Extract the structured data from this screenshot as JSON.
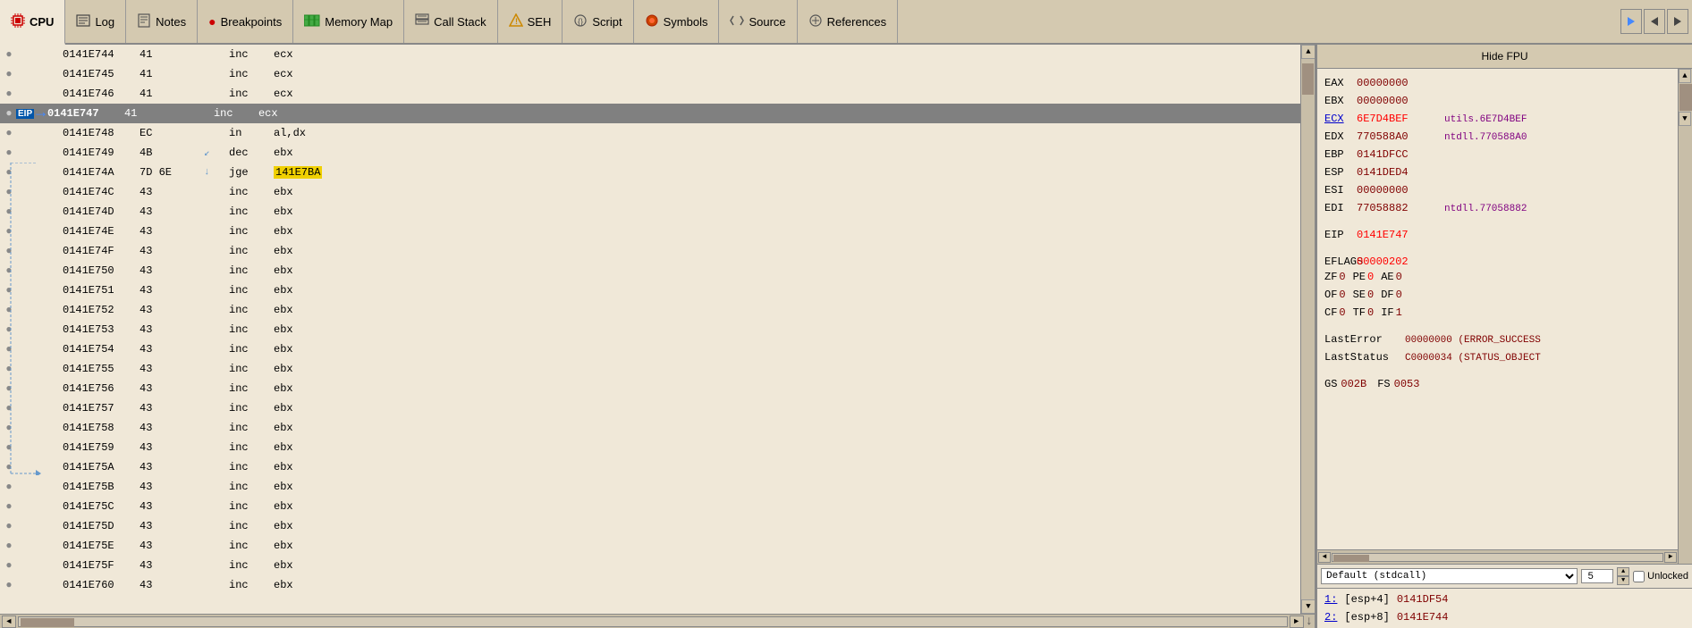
{
  "tabs": [
    {
      "id": "cpu",
      "label": "CPU",
      "icon": "cpu-icon",
      "active": true
    },
    {
      "id": "log",
      "label": "Log",
      "icon": "log-icon",
      "active": false
    },
    {
      "id": "notes",
      "label": "Notes",
      "icon": "notes-icon",
      "active": false
    },
    {
      "id": "breakpoints",
      "label": "Breakpoints",
      "icon": "breakpoints-icon",
      "active": false
    },
    {
      "id": "memmap",
      "label": "Memory Map",
      "icon": "memmap-icon",
      "active": false
    },
    {
      "id": "callstack",
      "label": "Call Stack",
      "icon": "callstack-icon",
      "active": false
    },
    {
      "id": "seh",
      "label": "SEH",
      "icon": "seh-icon",
      "active": false
    },
    {
      "id": "script",
      "label": "Script",
      "icon": "script-icon",
      "active": false
    },
    {
      "id": "symbols",
      "label": "Symbols",
      "icon": "symbols-icon",
      "active": false
    },
    {
      "id": "source",
      "label": "Source",
      "icon": "source-icon",
      "active": false
    },
    {
      "id": "references",
      "label": "References",
      "icon": "references-icon",
      "active": false
    }
  ],
  "disasm": {
    "rows": [
      {
        "addr": "0141E744",
        "hex": "41",
        "jump_arrow": "",
        "mnem": "inc",
        "oper": "ecx",
        "is_eip": false,
        "is_jge": false
      },
      {
        "addr": "0141E745",
        "hex": "41",
        "jump_arrow": "",
        "mnem": "inc",
        "oper": "ecx",
        "is_eip": false,
        "is_jge": false
      },
      {
        "addr": "0141E746",
        "hex": "41",
        "jump_arrow": "",
        "mnem": "inc",
        "oper": "ecx",
        "is_eip": false,
        "is_jge": false
      },
      {
        "addr": "0141E747",
        "hex": "41",
        "jump_arrow": "",
        "mnem": "inc",
        "oper": "ecx",
        "is_eip": true,
        "is_jge": false
      },
      {
        "addr": "0141E748",
        "hex": "EC",
        "jump_arrow": "",
        "mnem": "in",
        "oper": "al,dx",
        "is_eip": false,
        "is_jge": false
      },
      {
        "addr": "0141E749",
        "hex": "4B",
        "jump_arrow": "↙",
        "mnem": "dec",
        "oper": "ebx",
        "is_eip": false,
        "is_jge": false
      },
      {
        "addr": "0141E74A",
        "hex": "7D 6E",
        "jump_arrow": "↓",
        "mnem": "jge",
        "oper": "141E7BA",
        "is_eip": false,
        "is_jge": true
      },
      {
        "addr": "0141E74C",
        "hex": "43",
        "jump_arrow": "",
        "mnem": "inc",
        "oper": "ebx",
        "is_eip": false,
        "is_jge": false
      },
      {
        "addr": "0141E74D",
        "hex": "43",
        "jump_arrow": "",
        "mnem": "inc",
        "oper": "ebx",
        "is_eip": false,
        "is_jge": false
      },
      {
        "addr": "0141E74E",
        "hex": "43",
        "jump_arrow": "",
        "mnem": "inc",
        "oper": "ebx",
        "is_eip": false,
        "is_jge": false
      },
      {
        "addr": "0141E74F",
        "hex": "43",
        "jump_arrow": "",
        "mnem": "inc",
        "oper": "ebx",
        "is_eip": false,
        "is_jge": false
      },
      {
        "addr": "0141E750",
        "hex": "43",
        "jump_arrow": "",
        "mnem": "inc",
        "oper": "ebx",
        "is_eip": false,
        "is_jge": false
      },
      {
        "addr": "0141E751",
        "hex": "43",
        "jump_arrow": "",
        "mnem": "inc",
        "oper": "ebx",
        "is_eip": false,
        "is_jge": false
      },
      {
        "addr": "0141E752",
        "hex": "43",
        "jump_arrow": "",
        "mnem": "inc",
        "oper": "ebx",
        "is_eip": false,
        "is_jge": false
      },
      {
        "addr": "0141E753",
        "hex": "43",
        "jump_arrow": "",
        "mnem": "inc",
        "oper": "ebx",
        "is_eip": false,
        "is_jge": false
      },
      {
        "addr": "0141E754",
        "hex": "43",
        "jump_arrow": "",
        "mnem": "inc",
        "oper": "ebx",
        "is_eip": false,
        "is_jge": false
      },
      {
        "addr": "0141E755",
        "hex": "43",
        "jump_arrow": "",
        "mnem": "inc",
        "oper": "ebx",
        "is_eip": false,
        "is_jge": false
      },
      {
        "addr": "0141E756",
        "hex": "43",
        "jump_arrow": "",
        "mnem": "inc",
        "oper": "ebx",
        "is_eip": false,
        "is_jge": false
      },
      {
        "addr": "0141E757",
        "hex": "43",
        "jump_arrow": "",
        "mnem": "inc",
        "oper": "ebx",
        "is_eip": false,
        "is_jge": false
      },
      {
        "addr": "0141E758",
        "hex": "43",
        "jump_arrow": "",
        "mnem": "inc",
        "oper": "ebx",
        "is_eip": false,
        "is_jge": false
      },
      {
        "addr": "0141E759",
        "hex": "43",
        "jump_arrow": "",
        "mnem": "inc",
        "oper": "ebx",
        "is_eip": false,
        "is_jge": false
      },
      {
        "addr": "0141E75A",
        "hex": "43",
        "jump_arrow": "",
        "mnem": "inc",
        "oper": "ebx",
        "is_eip": false,
        "is_jge": false
      },
      {
        "addr": "0141E75B",
        "hex": "43",
        "jump_arrow": "",
        "mnem": "inc",
        "oper": "ebx",
        "is_eip": false,
        "is_jge": false
      },
      {
        "addr": "0141E75C",
        "hex": "43",
        "jump_arrow": "",
        "mnem": "inc",
        "oper": "ebx",
        "is_eip": false,
        "is_jge": false
      },
      {
        "addr": "0141E75D",
        "hex": "43",
        "jump_arrow": "",
        "mnem": "inc",
        "oper": "ebx",
        "is_eip": false,
        "is_jge": false
      },
      {
        "addr": "0141E75E",
        "hex": "43",
        "jump_arrow": "",
        "mnem": "inc",
        "oper": "ebx",
        "is_eip": false,
        "is_jge": false
      },
      {
        "addr": "0141E75F",
        "hex": "43",
        "jump_arrow": "",
        "mnem": "inc",
        "oper": "ebx",
        "is_eip": false,
        "is_jge": false
      },
      {
        "addr": "0141E760",
        "hex": "43",
        "jump_arrow": "",
        "mnem": "inc",
        "oper": "ebx",
        "is_eip": false,
        "is_jge": false
      }
    ]
  },
  "registers": {
    "hide_fpu_label": "Hide FPU",
    "regs": [
      {
        "name": "EAX",
        "value": "00000000",
        "hint": "",
        "linked": false,
        "changed": false
      },
      {
        "name": "EBX",
        "value": "00000000",
        "hint": "",
        "linked": false,
        "changed": false
      },
      {
        "name": "ECX",
        "value": "6E7D4BEF",
        "hint": "utils.6E7D4BEF",
        "linked": true,
        "changed": true
      },
      {
        "name": "EDX",
        "value": "770588A0",
        "hint": "ntdll.770588A0",
        "linked": false,
        "changed": false
      },
      {
        "name": "EBP",
        "value": "0141DFCC",
        "hint": "",
        "linked": false,
        "changed": false
      },
      {
        "name": "ESP",
        "value": "0141DED4",
        "hint": "",
        "linked": false,
        "changed": false
      },
      {
        "name": "ESI",
        "value": "00000000",
        "hint": "",
        "linked": false,
        "changed": false
      },
      {
        "name": "EDI",
        "value": "77058882",
        "hint": "ntdll.77058882",
        "linked": false,
        "changed": false
      }
    ],
    "eip": {
      "name": "EIP",
      "value": "0141E747",
      "changed": true
    },
    "eflags": {
      "name": "EFLAGS",
      "value": "00000202"
    },
    "flags": [
      {
        "name": "ZF",
        "value": "0",
        "changed": false
      },
      {
        "name": "PE",
        "value": "0",
        "changed": true
      },
      {
        "name": "AE",
        "value": "0",
        "changed": false
      },
      {
        "name": "OF",
        "value": "0",
        "changed": false
      },
      {
        "name": "SE",
        "value": "0",
        "changed": false
      },
      {
        "name": "DF",
        "value": "0",
        "changed": false
      },
      {
        "name": "CF",
        "value": "0",
        "changed": false
      },
      {
        "name": "TF",
        "value": "0",
        "changed": false
      },
      {
        "name": "IF",
        "value": "1",
        "changed": false
      }
    ],
    "lasterror": {
      "label": "LastError",
      "value": "00000000 (ERROR_SUCCESS"
    },
    "laststatus": {
      "label": "LastStatus",
      "value": "C0000034 (STATUS_OBJECT"
    },
    "segments": [
      {
        "name": "GS",
        "value": "002B"
      },
      {
        "name": "FS",
        "value": "0053"
      }
    ],
    "calling_conv": "Default (stdcall)",
    "stack_count": "5",
    "unlocked": true,
    "stack_items": [
      {
        "label": "1:",
        "ref": "[esp+4]",
        "addr": "0141DF54"
      },
      {
        "label": "2:",
        "ref": "[esp+8]",
        "addr": "0141E744"
      }
    ]
  }
}
